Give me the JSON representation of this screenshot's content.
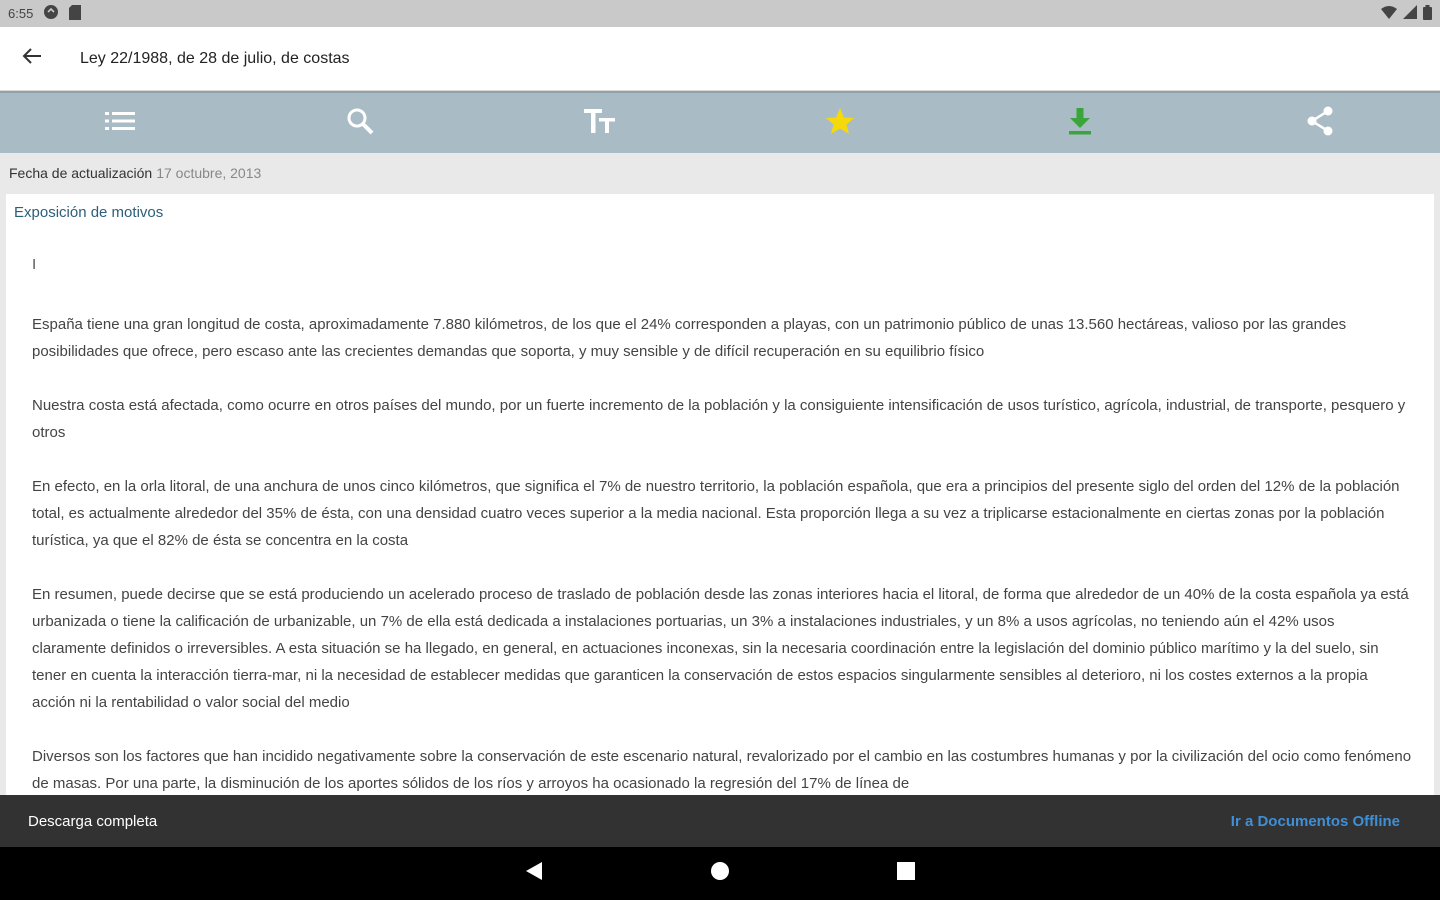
{
  "status_bar": {
    "time": "6:55"
  },
  "app_bar": {
    "title": "Ley 22/1988, de 28 de julio, de costas"
  },
  "toolbar": {
    "items": [
      "index-icon",
      "search-icon",
      "text-size-icon",
      "star-icon",
      "download-icon",
      "share-icon"
    ],
    "star_color": "#f5d90a",
    "download_color": "#3aa53a"
  },
  "update": {
    "label": "Fecha de actualización",
    "date": "17 octubre, 2013"
  },
  "content": {
    "section_title": "Exposición de motivos",
    "roman": "I",
    "paragraphs": [
      "España tiene una gran longitud de costa, aproximadamente 7.880 kilómetros, de los que el 24% corresponden a playas, con un patrimonio público de unas 13.560 hectáreas, valioso por las grandes posibilidades que ofrece, pero escaso ante las crecientes demandas que soporta, y muy sensible y de difícil recuperación en su equilibrio físico",
      "Nuestra costa está afectada, como ocurre en otros países del mundo, por un fuerte incremento de la población y la consiguiente intensificación de usos turístico, agrícola, industrial, de transporte, pesquero y otros",
      "En efecto, en la orla litoral, de una anchura de unos cinco kilómetros, que significa el 7% de nuestro territorio, la población española, que era a principios del presente siglo del orden del 12% de la población total, es actualmente alrededor del 35% de ésta, con una densidad cuatro veces superior a la media nacional. Esta proporción llega a su vez a triplicarse estacionalmente en ciertas zonas por la población turística, ya que el 82% de ésta se concentra en la costa",
      "En resumen, puede decirse que se está produciendo un acelerado proceso de traslado de población desde las zonas interiores hacia el litoral, de forma que alrededor de un 40% de la costa española ya está urbanizada o tiene la calificación de urbanizable, un 7% de ella está dedicada a instalaciones portuarias, un 3% a instalaciones industriales, y un 8% a usos agrícolas, no teniendo aún el 42% usos claramente definidos o irreversibles. A esta situación se ha llegado, en general, en actuaciones inconexas, sin la necesaria coordinación entre la legislación del dominio público marítimo y la del suelo, sin tener en cuenta la interacción tierra-mar, ni la necesidad de establecer medidas que garanticen la conservación de estos espacios singularmente sensibles al deterioro, ni los costes externos a la propia acción ni la rentabilidad o valor social del medio",
      "Diversos son los factores que han incidido negativamente sobre la conservación de este escenario natural, revalorizado por el cambio en las costumbres humanas y por la civilización del ocio como fenómeno de masas. Por una parte, la disminución de los aportes sólidos de los ríos y arroyos ha ocasionado la regresión del 17% de línea de"
    ]
  },
  "snackbar": {
    "message": "Descarga completa",
    "action": "Ir a Documentos Offline",
    "action_color": "#3f8fd6"
  },
  "nav_bar": {
    "items": [
      "back-triangle-icon",
      "home-circle-icon",
      "recents-square-icon"
    ]
  }
}
